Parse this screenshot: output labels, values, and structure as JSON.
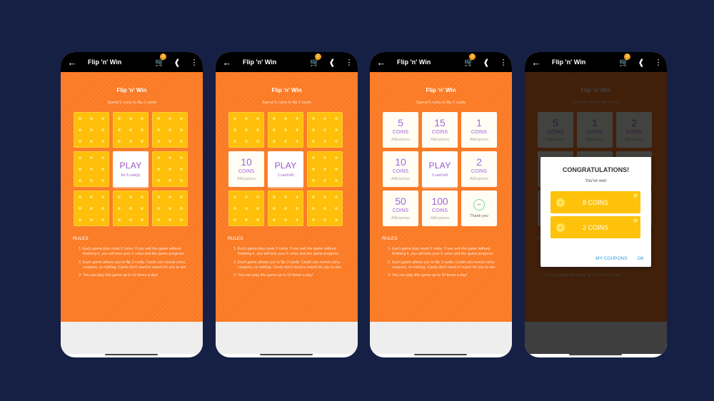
{
  "app": {
    "title": "Flip 'n' Win",
    "cart_badge": "2",
    "icons": {
      "back": "arrow-left-icon",
      "cart": "cart-icon",
      "share": "share-icon",
      "more": "more-vert-icon"
    }
  },
  "game": {
    "title": "Flip 'n' Win",
    "subtitle": "Spend 5 coins to flip 2 cards"
  },
  "rules": {
    "title": "RULES",
    "items": [
      "Each game play costs 5 coins. If you exit the game without finishing it, you will lose your 5 coins and the game progress.",
      "Each game allows you to flip 2 cards. Cards can reveal coins, coupons, or nothing. Cards don't need to match for you to win.",
      "You can play this game up to 10 times a day!"
    ]
  },
  "card_text": {
    "unit": "COINS",
    "brand": "AliExpress",
    "play": "PLAY",
    "thank_you": "Thank you"
  },
  "screens": [
    {
      "play_note": "for 5 coin(s)",
      "cards": [
        "back",
        "back",
        "back",
        "back",
        "play",
        "back",
        "back",
        "back",
        "back"
      ]
    },
    {
      "play_note": "1 card left",
      "cards": [
        "back",
        "back",
        "back",
        "10",
        "play",
        "back",
        "back",
        "back",
        "back"
      ]
    },
    {
      "play_note": "2 card left",
      "cards": [
        "5",
        "15",
        "1",
        "10",
        "play",
        "2",
        "50",
        "100",
        "thanks"
      ]
    },
    {
      "visible_cards": [
        "5",
        "1",
        "2"
      ]
    }
  ],
  "dialog": {
    "title": "CONGRATULATIONS!",
    "subtitle": "You've won",
    "prizes": [
      "8 COINS",
      "2 COINS"
    ],
    "my_coupons": "MY COUPONS",
    "ok": "OK"
  }
}
